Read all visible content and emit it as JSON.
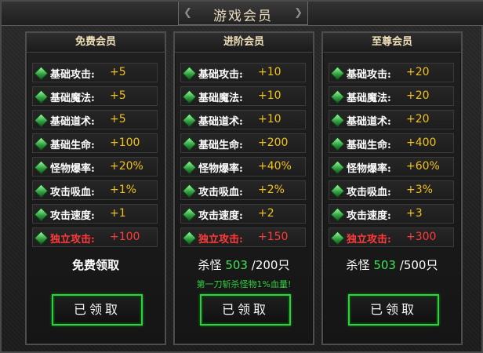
{
  "window": {
    "title": "游戏会员"
  },
  "tiers": [
    {
      "name": "免费会员",
      "rows": [
        {
          "label": "基础攻击:",
          "value": "+5"
        },
        {
          "label": "基础魔法:",
          "value": "+5"
        },
        {
          "label": "基础道术:",
          "value": "+5"
        },
        {
          "label": "基础生命:",
          "value": "+100"
        },
        {
          "label": "怪物爆率:",
          "value": "+20%"
        },
        {
          "label": "攻击吸血:",
          "value": "+1%"
        },
        {
          "label": "攻击速度:",
          "value": "+1"
        },
        {
          "label": "独立攻击:",
          "value": "+100"
        }
      ],
      "requirement": "免费领取",
      "button": "已领取"
    },
    {
      "name": "进阶会员",
      "rows": [
        {
          "label": "基础攻击:",
          "value": "+10"
        },
        {
          "label": "基础魔法:",
          "value": "+10"
        },
        {
          "label": "基础道术:",
          "value": "+10"
        },
        {
          "label": "基础生命:",
          "value": "+200"
        },
        {
          "label": "怪物爆率:",
          "value": "+40%"
        },
        {
          "label": "攻击吸血:",
          "value": "+2%"
        },
        {
          "label": "攻击速度:",
          "value": "+2"
        },
        {
          "label": "独立攻击:",
          "value": "+150"
        }
      ],
      "kill_label": "杀怪",
      "kill_count": "503",
      "kill_target": "/200只",
      "note": "第一刀斩杀怪物1%血量!",
      "button": "已领取"
    },
    {
      "name": "至尊会员",
      "rows": [
        {
          "label": "基础攻击:",
          "value": "+20"
        },
        {
          "label": "基础魔法:",
          "value": "+20"
        },
        {
          "label": "基础道术:",
          "value": "+20"
        },
        {
          "label": "基础生命:",
          "value": "+400"
        },
        {
          "label": "怪物爆率:",
          "value": "+60%"
        },
        {
          "label": "攻击吸血:",
          "value": "+3%"
        },
        {
          "label": "攻击速度:",
          "value": "+3"
        },
        {
          "label": "独立攻击:",
          "value": "+300"
        }
      ],
      "kill_label": "杀怪",
      "kill_count": "503",
      "kill_target": "/500只",
      "button": "已领取"
    }
  ],
  "colors": {
    "stat_value": "#f1c21b",
    "special_stat": "#ff3b3b",
    "kill_count": "#44e25a",
    "button_border": "#2ad23c"
  },
  "icons": {
    "row_bullet": "green-gem-icon"
  }
}
